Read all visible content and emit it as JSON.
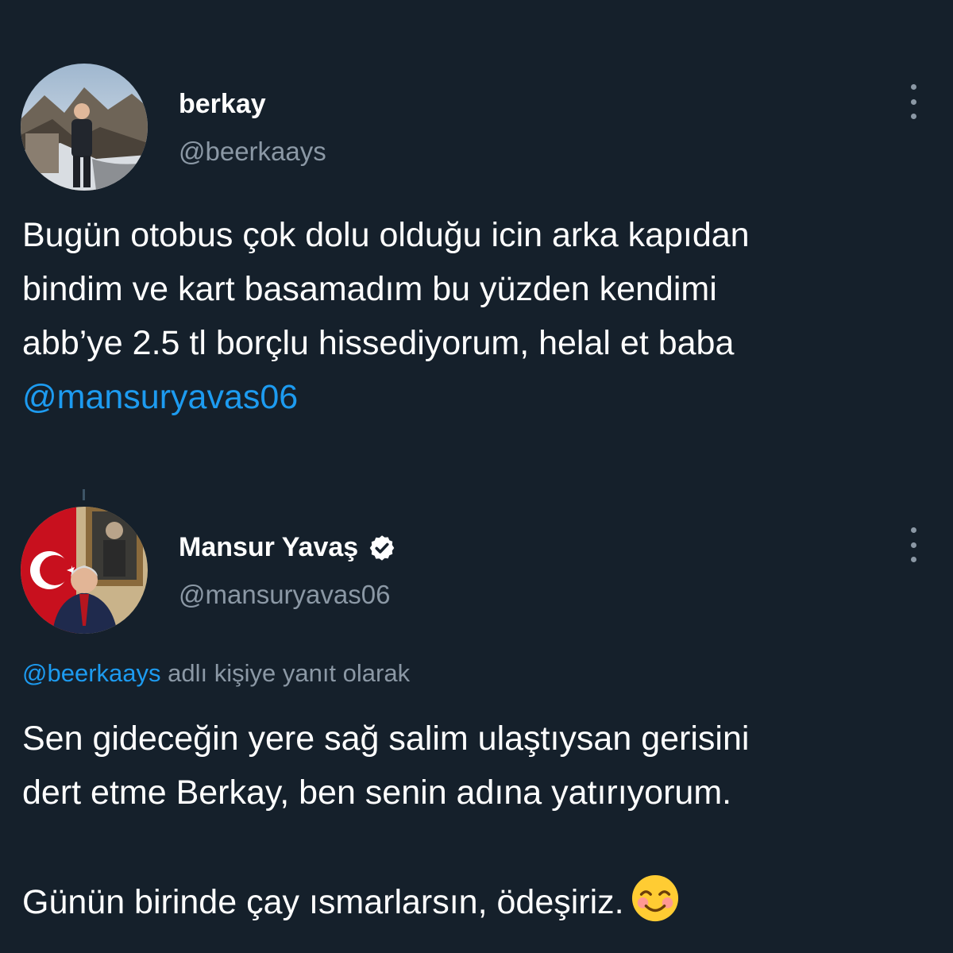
{
  "original_tweet": {
    "display_name": "berkay",
    "handle": "@beerkaays",
    "text_line_1": "Bugün otobus çok dolu olduğu icin arka kapıdan",
    "text_line_2": "bindim ve kart basamadım bu yüzden kendimi",
    "text_line_3": "abb’ye 2.5 tl borçlu hissediyorum, helal et baba",
    "mention": "@mansuryavas06"
  },
  "reply_tweet": {
    "display_name": "Mansur Yavaş",
    "verified": true,
    "handle": "@mansuryavas06",
    "reply_to_mention": "@beerkaays",
    "reply_to_suffix": " adlı kişiye yanıt olarak",
    "text_line_1": "Sen gideceğin yere sağ salim ulaştıysan gerisini",
    "text_line_2": "dert etme Berkay, ben senin adına yatırıyorum.",
    "text_line_3": "Günün birinde çay ısmarlarsın, ödeşiriz.",
    "emoji": "smiling-face-with-smiling-eyes-icon"
  },
  "colors": {
    "background": "#15202b",
    "primary_text": "#ffffff",
    "secondary_text": "#8b98a5",
    "link": "#1d9bf0",
    "verified_badge": "#ffffff"
  }
}
